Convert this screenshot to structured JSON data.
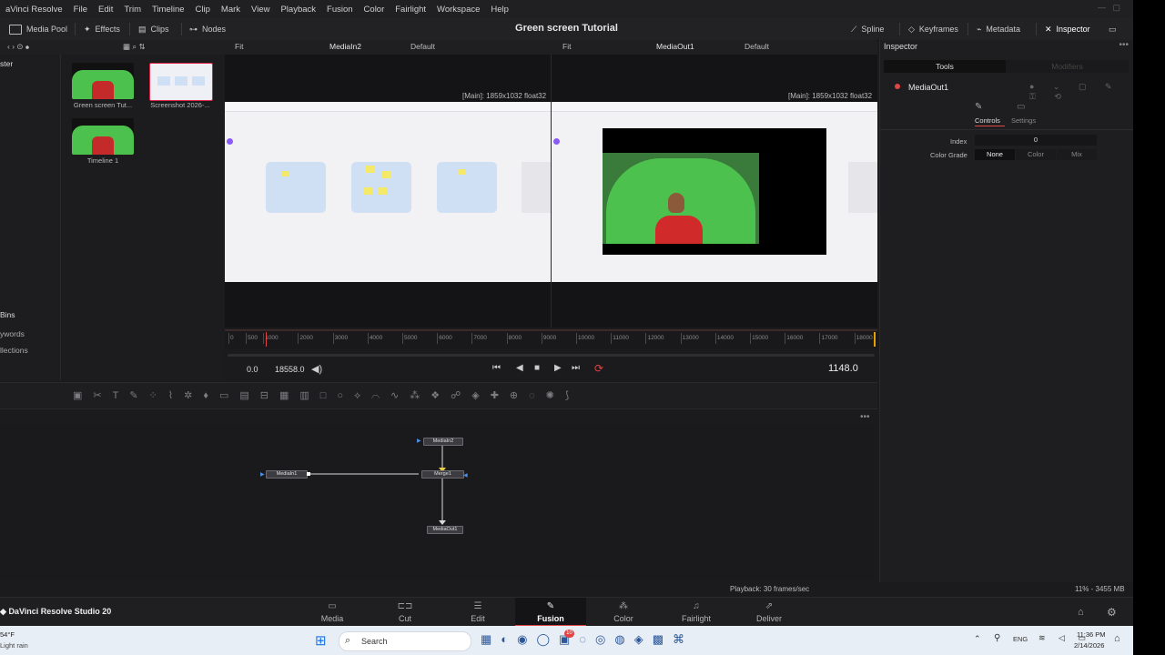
{
  "menu": [
    "aVinci Resolve",
    "File",
    "Edit",
    "Trim",
    "Timeline",
    "Clip",
    "Mark",
    "View",
    "Playback",
    "Fusion",
    "Color",
    "Fairlight",
    "Workspace",
    "Help"
  ],
  "toolbar": {
    "media_pool": "Media Pool",
    "effects": "Effects",
    "clips": "Clips",
    "nodes": "Nodes",
    "title": "Green screen Tutorial",
    "spline": "Spline",
    "keyframes": "Keyframes",
    "metadata": "Metadata",
    "inspector": "Inspector"
  },
  "viewer_left": {
    "fit": "Fit",
    "name": "MediaIn2",
    "default": "Default",
    "info": "[Main]: 1859x1032 float32"
  },
  "viewer_right": {
    "fit": "Fit",
    "name": "MediaOut1",
    "default": "Default",
    "info": "[Main]: 1859x1032 float32"
  },
  "mediapool": {
    "left_label_top": "ster",
    "left_bins": "Bins",
    "left_keywords": "ywords",
    "left_collections": "llections",
    "items": [
      {
        "label": "Green screen Tut..."
      },
      {
        "label": "Screenshot 2026-..."
      },
      {
        "label": "Timeline 1"
      }
    ]
  },
  "ruler_ticks": [
    "0",
    "500",
    "1000",
    "2000",
    "3000",
    "4000",
    "5000",
    "6000",
    "7000",
    "8000",
    "9000",
    "10000",
    "11000",
    "12000",
    "13000",
    "14000",
    "15000",
    "16000",
    "17000",
    "18000"
  ],
  "transport": {
    "start": "0.0",
    "end": "18558.0",
    "current": "1148.0"
  },
  "nodes": {
    "media_in2": "MediaIn2",
    "media_in1": "MediaIn1",
    "merge1": "Merge1",
    "media_out1": "MediaOut1"
  },
  "inspector": {
    "header": "Inspector",
    "tab_tools": "Tools",
    "tab_modifiers": "Modifiers",
    "node_name": "MediaOut1",
    "sub_controls": "Controls",
    "sub_settings": "Settings",
    "index_label": "Index",
    "index_value": "0",
    "color_grade_label": "Color Grade",
    "cg_none": "None",
    "cg_color": "Color",
    "cg_mix": "Mix"
  },
  "status": {
    "playback": "Playback: 30 frames/sec",
    "memory": "11% - 3455 MB"
  },
  "app_name": "DaVinci Resolve Studio 20",
  "pages": [
    "Media",
    "Cut",
    "Edit",
    "Fusion",
    "Color",
    "Fairlight",
    "Deliver"
  ],
  "active_page": "Fusion",
  "taskbar": {
    "weather_temp": "54°F",
    "weather_desc": "Light rain",
    "search": "Search",
    "lang": "ENG",
    "time": "11:36 PM",
    "date": "2/14/2026",
    "badge": "10"
  },
  "colors": {
    "accent_red": "#e04444",
    "green_screen": "#4dc14d"
  }
}
